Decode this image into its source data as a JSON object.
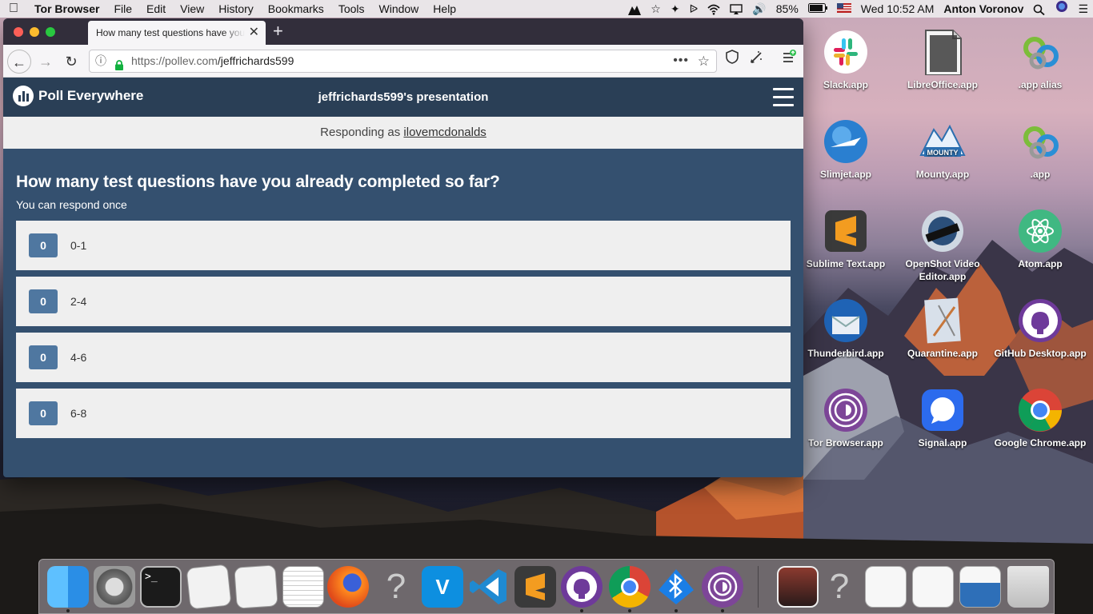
{
  "menubar": {
    "app": "Tor Browser",
    "items": [
      "File",
      "Edit",
      "View",
      "History",
      "Bookmarks",
      "Tools",
      "Window",
      "Help"
    ],
    "battery": "85%",
    "clock": "Wed 10:52 AM",
    "user": "Anton Voronov"
  },
  "browser": {
    "tab_title": "How many test questions have you already completed so far?",
    "url_host": "https://pollev.com",
    "url_path": "/jeffrichards599"
  },
  "page": {
    "brand": "Poll Everywhere",
    "presentation_title": "jeffrichards599's presentation",
    "responding_prefix": "Responding as ",
    "username": "ilovemcdonalds",
    "question": "How many test questions have you already completed so far?",
    "subtitle": "You can respond once",
    "options": [
      {
        "count": "0",
        "label": "0-1"
      },
      {
        "count": "0",
        "label": "2-4"
      },
      {
        "count": "0",
        "label": "4-6"
      },
      {
        "count": "0",
        "label": "6-8"
      }
    ]
  },
  "desktop_icons": [
    {
      "label": "Slack.app",
      "icon": "slack-icon"
    },
    {
      "label": "LibreOffice.app",
      "icon": "libreoffice-icon"
    },
    {
      "label": ".app alias",
      "icon": "alias-icon"
    },
    {
      "label": "Slimjet.app",
      "icon": "slimjet-icon"
    },
    {
      "label": "Mounty.app",
      "icon": "mounty-icon"
    },
    {
      "label": ".app",
      "icon": "app-icon"
    },
    {
      "label": "Sublime Text.app",
      "icon": "sublime-icon"
    },
    {
      "label": "OpenShot Video Editor.app",
      "icon": "openshot-icon"
    },
    {
      "label": "Atom.app",
      "icon": "atom-icon"
    },
    {
      "label": "Thunderbird.app",
      "icon": "thunderbird-icon"
    },
    {
      "label": "Quarantine.app",
      "icon": "quarantine-icon"
    },
    {
      "label": "GitHub Desktop.app",
      "icon": "github-icon"
    },
    {
      "label": "Tor Browser.app",
      "icon": "tor-icon"
    },
    {
      "label": "Signal.app",
      "icon": "signal-icon"
    },
    {
      "label": "Google Chrome.app",
      "icon": "chrome-icon"
    }
  ],
  "colors": {
    "pe_dark": "#2a3f56",
    "pe_body": "#34506f",
    "count_badge": "#4f77a0"
  }
}
